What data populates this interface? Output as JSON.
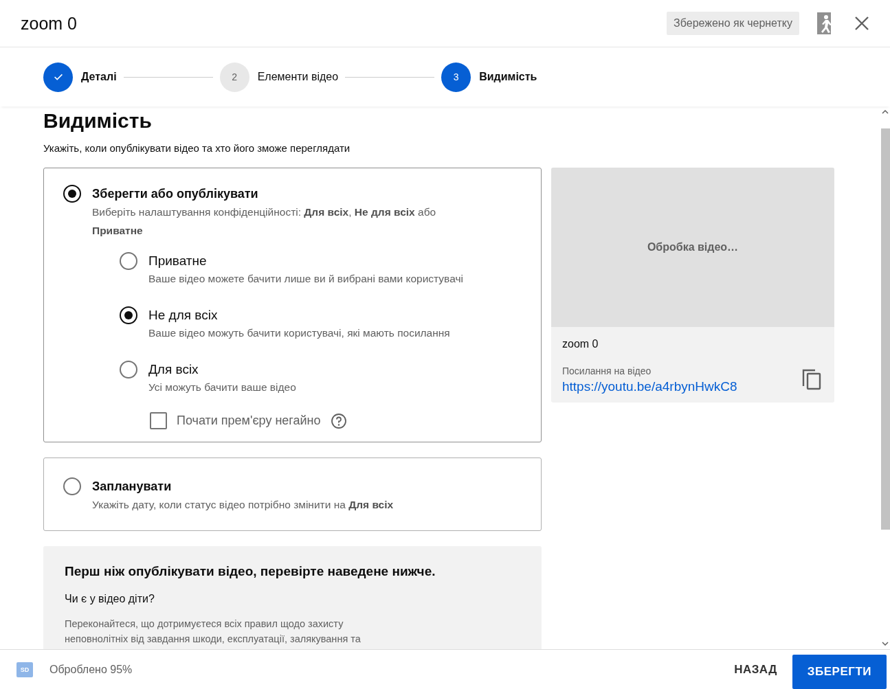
{
  "header": {
    "title": "zoom 0",
    "draft_badge": "Збережено як чернетку"
  },
  "steps": [
    {
      "label": "Деталі",
      "completed": true,
      "selected": false
    },
    {
      "number": "2",
      "label": "Елементи відео",
      "completed": false,
      "selected": false
    },
    {
      "number": "3",
      "label": "Видимість",
      "completed": false,
      "selected": true
    }
  ],
  "heading": "Видимість",
  "subtitle": "Укажіть, коли опублікувати відео та хто його зможе переглядати",
  "publish_option": {
    "selected": true,
    "title": "Зберегти або опублікувати",
    "description": "Виберіть налаштування конфіденційності: **Для всіх**, **Не для всіх** або **Приватне**",
    "options": [
      {
        "label": "Приватне",
        "description": "Ваше відео можете бачити лише ви й вибрані вами користувачі",
        "selected": false
      },
      {
        "label": "Не для всіх",
        "description": "Ваше відео можуть бачити користувачі, які мають посилання",
        "selected": true
      },
      {
        "label": "Для всіх",
        "description": "Усі можуть бачити ваше відео",
        "selected": false
      }
    ],
    "premiere": {
      "label": "Почати прем'єру негайно",
      "checked": false
    }
  },
  "schedule_option": {
    "selected": false,
    "title": "Запланувати",
    "description": "Укажіть дату, коли статус відео потрібно змінити на **Для всіх**"
  },
  "checklist": {
    "title": "Перш ніж опублікувати відео, перевірте наведене нижче.",
    "question": "Чи є у відео діти?",
    "text_lines": [
      "Переконайтеся, що дотримуєтеся всіх правил щодо захисту",
      "неповнолітніх від завдання шкоди, експлуатації, залякування та"
    ]
  },
  "preview": {
    "status": "Обробка відео…",
    "video_title": "zoom 0",
    "link_label": "Посилання на відео",
    "link": "https://youtu.be/a4rbynHwkC8"
  },
  "footer": {
    "badge": "SD",
    "status": "Оброблено 95%",
    "buttons": [
      {
        "label": "НАЗАД",
        "kind": "text"
      },
      {
        "label": "ЗБЕРЕГТИ",
        "kind": "primary"
      }
    ]
  }
}
